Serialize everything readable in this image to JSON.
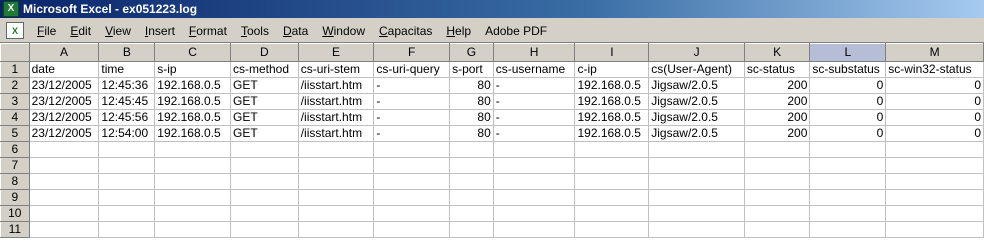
{
  "window": {
    "title": "Microsoft Excel - ex051223.log",
    "app_icon": "excel-icon"
  },
  "menu": {
    "items": [
      {
        "acc": "F",
        "rest": "ile"
      },
      {
        "acc": "E",
        "rest": "dit"
      },
      {
        "acc": "V",
        "rest": "iew"
      },
      {
        "acc": "I",
        "rest": "nsert"
      },
      {
        "acc": "F",
        "rest": "ormat",
        "pre": ""
      },
      {
        "acc": "T",
        "rest": "ools"
      },
      {
        "acc": "D",
        "rest": "ata"
      },
      {
        "acc": "W",
        "rest": "indow"
      },
      {
        "acc": "C",
        "rest": "apacitas"
      },
      {
        "acc": "H",
        "rest": "elp"
      },
      {
        "acc": "",
        "rest": "Adobe PDF"
      }
    ]
  },
  "sheet": {
    "columns": [
      "A",
      "B",
      "C",
      "D",
      "E",
      "F",
      "G",
      "H",
      "I",
      "J",
      "K",
      "L",
      "M"
    ],
    "selected_column": "L",
    "row_numbers": [
      "1",
      "2",
      "3",
      "4",
      "5",
      "6",
      "7",
      "8",
      "9",
      "10",
      "11"
    ],
    "header_row": [
      "date",
      "time",
      "s-ip",
      "cs-method",
      "cs-uri-stem",
      "cs-uri-query",
      "s-port",
      "cs-username",
      "c-ip",
      "cs(User-Agent)",
      "sc-status",
      "sc-substatus",
      "sc-win32-status"
    ],
    "rows": [
      [
        "23/12/2005",
        "12:45:36",
        "192.168.0.5",
        "GET",
        "/iisstart.htm",
        "-",
        "80",
        "-",
        "192.168.0.5",
        "Jigsaw/2.0.5",
        "200",
        "0",
        "0"
      ],
      [
        "23/12/2005",
        "12:45:45",
        "192.168.0.5",
        "GET",
        "/iisstart.htm",
        "-",
        "80",
        "-",
        "192.168.0.5",
        "Jigsaw/2.0.5",
        "200",
        "0",
        "0"
      ],
      [
        "23/12/2005",
        "12:45:56",
        "192.168.0.5",
        "GET",
        "/iisstart.htm",
        "-",
        "80",
        "-",
        "192.168.0.5",
        "Jigsaw/2.0.5",
        "200",
        "0",
        "0"
      ],
      [
        "23/12/2005",
        "12:54:00",
        "192.168.0.5",
        "GET",
        "/iisstart.htm",
        "-",
        "80",
        "-",
        "192.168.0.5",
        "Jigsaw/2.0.5",
        "200",
        "0",
        "0"
      ]
    ],
    "numeric_columns": [
      6,
      10,
      11,
      12
    ]
  }
}
